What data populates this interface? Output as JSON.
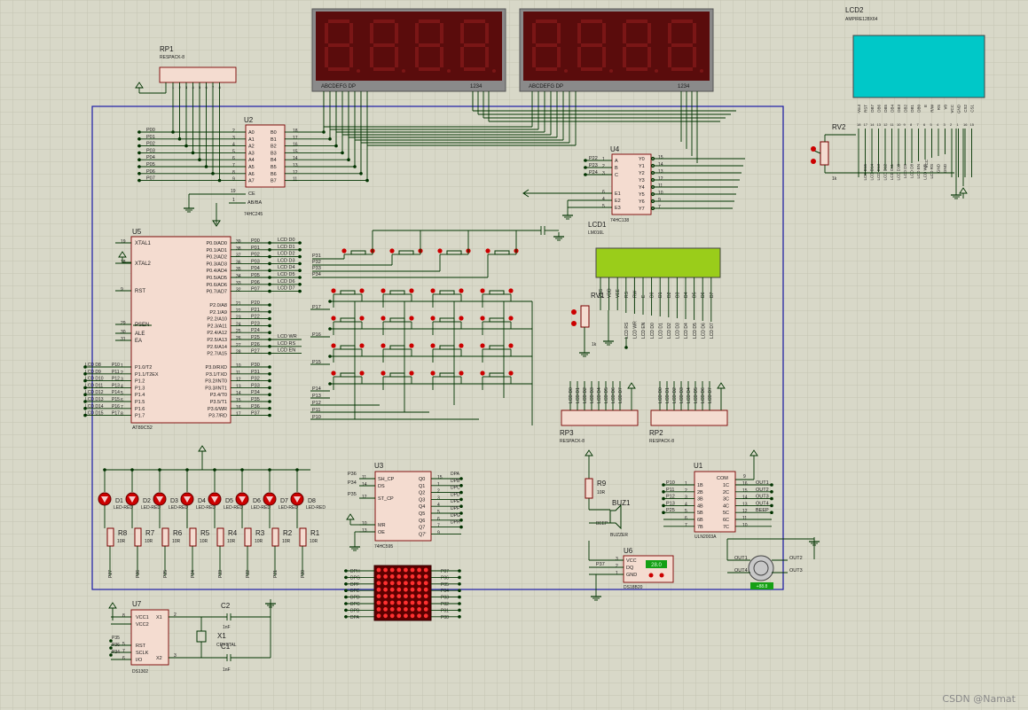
{
  "colors": {
    "grid": "#c8c8b8",
    "background": "#d8d8c8",
    "wire": "#003300",
    "chip_fill": "#f4dcd0",
    "chip_stroke": "#7a0000",
    "board_frame": "#1a1aa6",
    "segment_display_bg": "#5a0c0c",
    "segment_dim": "#7a1616",
    "glcd_screen": "#00c8c8",
    "lcd1602_screen": "#9acd1a",
    "led_red": "#cc0000",
    "matrix_bg": "#5c0000",
    "matrix_dot": "#ff3030",
    "button_red": "#cc0000",
    "temp_display": "#15a015"
  },
  "components": {
    "rp1": {
      "ref": "RP1",
      "value": "RESPACK-8"
    },
    "rp2": {
      "ref": "RP2",
      "value": "RESPACK-8"
    },
    "rp3": {
      "ref": "RP3",
      "value": "RESPACK-8"
    },
    "u2": {
      "ref": "U2",
      "value": "74HC245",
      "left_pins": [
        "A0",
        "A1",
        "A2",
        "A3",
        "A4",
        "A5",
        "A6",
        "A7"
      ],
      "right_pins": [
        "B0",
        "B1",
        "B2",
        "B3",
        "B4",
        "B5",
        "B6",
        "B7"
      ],
      "left_nums": [
        "2",
        "3",
        "4",
        "5",
        "6",
        "7",
        "8",
        "9"
      ],
      "right_nums": [
        "18",
        "17",
        "16",
        "15",
        "14",
        "13",
        "12",
        "11"
      ],
      "ce": "CE",
      "ab": "AB/BA",
      "ce_num": "19",
      "ab_num": "1"
    },
    "u4": {
      "ref": "U4",
      "value": "74HC138",
      "inputs": [
        "A",
        "B",
        "C"
      ],
      "enables": [
        "E1",
        "E2",
        "E3"
      ],
      "outputs": [
        "Y0",
        "Y1",
        "Y2",
        "Y3",
        "Y4",
        "Y5",
        "Y6",
        "Y7"
      ],
      "in_nums": [
        "1",
        "2",
        "3"
      ],
      "en_nums": [
        "6",
        "4",
        "5"
      ],
      "out_nums": [
        "15",
        "14",
        "13",
        "12",
        "11",
        "10",
        "9",
        "7"
      ],
      "in_nets": [
        "P22",
        "P23",
        "P24"
      ]
    },
    "u5": {
      "ref": "U5",
      "value": "AT89C52",
      "left_pins": [
        [
          "19",
          "XTAL1"
        ],
        [
          "18",
          "XTAL2"
        ],
        [
          "9",
          "RST"
        ],
        [
          "29",
          "PSEN"
        ],
        [
          "30",
          "ALE"
        ],
        [
          "31",
          "EA"
        ]
      ],
      "p0": [
        "P0.0/AD0",
        "P0.1/AD1",
        "P0.2/AD2",
        "P0.3/AD3",
        "P0.4/AD4",
        "P0.5/AD5",
        "P0.6/AD6",
        "P0.7/AD7"
      ],
      "p0_nums": [
        "39",
        "38",
        "37",
        "36",
        "35",
        "34",
        "33",
        "32"
      ],
      "p0_nets": [
        "P00",
        "P01",
        "P02",
        "P03",
        "P04",
        "P05",
        "P06",
        "P07"
      ],
      "p2": [
        "P2.0/A8",
        "P2.1/A9",
        "P2.2/A10",
        "P2.3/A11",
        "P2.4/A12",
        "P2.5/A13",
        "P2.6/A14",
        "P2.7/A15"
      ],
      "p2_nums": [
        "21",
        "22",
        "23",
        "24",
        "25",
        "26",
        "27",
        "28"
      ],
      "p2_nets": [
        "P20",
        "P21",
        "P22",
        "P23",
        "P24",
        "P25",
        "P26",
        "P27"
      ],
      "p3": [
        "P3.0/RXD",
        "P3.1/TXD",
        "P3.2/INT0",
        "P3.3/INT1",
        "P3.4/T0",
        "P3.5/T1",
        "P3.6/WR",
        "P3.7/RD"
      ],
      "p3_nums": [
        "10",
        "11",
        "12",
        "13",
        "14",
        "15",
        "16",
        "17"
      ],
      "p3_nets": [
        "P30",
        "P31",
        "P32",
        "P33",
        "P34",
        "P35",
        "P36",
        "P37"
      ],
      "p1": [
        "P1.0/T2",
        "P1.1/T2EX",
        "P1.2",
        "P1.3",
        "P1.4",
        "P1.5",
        "P1.6",
        "P1.7"
      ],
      "p1_nums": [
        "1",
        "2",
        "3",
        "4",
        "5",
        "6",
        "7",
        "8"
      ],
      "p1_nets": [
        "P10",
        "P11",
        "P12",
        "P13",
        "P14",
        "P15",
        "P16",
        "P17"
      ],
      "p1_lcd": [
        "LCD D8",
        "LCD D9",
        "LCD D10",
        "LCD D11",
        "LCD D12",
        "LCD D13",
        "LCD D14",
        "LCD D15"
      ],
      "p0_lcd": [
        "LCD D0",
        "LCD D1",
        "LCD D2",
        "LCD D3",
        "LCD D4",
        "LCD D5",
        "LCD D6",
        "LCD D7"
      ],
      "p2_lcd": [
        "LCD WR",
        "LCD RS",
        "LCD EN"
      ]
    },
    "u3": {
      "ref": "U3",
      "value": "74HC595",
      "left": [
        [
          "14",
          "DS"
        ],
        [
          "11",
          "SH_CP"
        ],
        [
          "12",
          "ST_CP"
        ],
        [
          "10",
          "MR"
        ],
        [
          "13",
          "OE"
        ]
      ],
      "right": [
        "Q0",
        "Q1",
        "Q2",
        "Q3",
        "Q4",
        "Q5",
        "Q6",
        "Q7",
        "Q7'"
      ],
      "right_nums": [
        "15",
        "1",
        "2",
        "3",
        "4",
        "5",
        "6",
        "7",
        "9"
      ],
      "nets_in": [
        "P36",
        "P34",
        "P35"
      ],
      "nets_out": [
        "DPA",
        "DPB",
        "DPC",
        "DPD",
        "DPE",
        "DPF",
        "DPG",
        "DPH"
      ]
    },
    "u1": {
      "ref": "U1",
      "value": "ULN2003A",
      "in": [
        "1B",
        "2B",
        "3B",
        "4B",
        "5B",
        "6B",
        "7B"
      ],
      "out": [
        "1C",
        "2C",
        "3C",
        "4C",
        "5C",
        "6C",
        "7C"
      ],
      "com": "COM",
      "in_nums": [
        "1",
        "2",
        "3",
        "4",
        "5",
        "6",
        "7"
      ],
      "out_nums": [
        "16",
        "15",
        "14",
        "13",
        "12",
        "11",
        "10"
      ],
      "in_nets": [
        "P10",
        "P11",
        "P12",
        "P13",
        "P25"
      ],
      "out_nets": [
        "OUT1",
        "OUT2",
        "OUT3",
        "OUT4",
        "BEEP"
      ],
      "com_num": "9"
    },
    "u6": {
      "ref": "U6",
      "value": "DS18B20",
      "pins": [
        "VCC",
        "DQ",
        "GND"
      ],
      "nums": [
        "3",
        "2",
        "1"
      ],
      "net": "P37",
      "display": "28.0"
    },
    "u7": {
      "ref": "U7",
      "value": "DS1302",
      "pins_left": [
        "VCC1",
        "VCC2",
        "RST",
        "SCLK",
        "I/O"
      ],
      "pins_right": [
        "X1",
        "X2"
      ],
      "nets": [
        "P35",
        "P36",
        "P34"
      ],
      "nums_left": [
        "8",
        "",
        "5",
        "7",
        "6"
      ],
      "nums_right": [
        "2",
        "3"
      ]
    },
    "lcd1": {
      "ref": "LCD1",
      "value": "LM016L",
      "pins": [
        "VSS",
        "VDD",
        "VEE",
        "RS",
        "RW",
        "E",
        "D0",
        "D1",
        "D2",
        "D3",
        "D4",
        "D5",
        "D6",
        "D7"
      ],
      "nets": [
        "LCD RS",
        "LCD WR",
        "LCD EN",
        "LCD D0",
        "LCD D1",
        "LCD D2",
        "LCD D3",
        "LCD D4",
        "LCD D5",
        "LCD D6",
        "LCD D7"
      ]
    },
    "lcd2": {
      "ref": "LCD2",
      "value": "AMPIRE128X64",
      "pins": [
        "-Vout",
        "RST",
        "DB7",
        "DB6",
        "DB5",
        "DB4",
        "DB3",
        "DB2",
        "DB1",
        "DB0",
        "E",
        "R/W",
        "RS",
        "V0",
        "VCC",
        "GND",
        "CS2",
        "CS1"
      ],
      "nums": [
        "18",
        "17",
        "14",
        "13",
        "12",
        "11",
        "10",
        "9",
        "8",
        "7",
        "6",
        "5",
        "4",
        "3",
        "2",
        "1",
        "16",
        "15"
      ],
      "nets": [
        "LCD D15",
        "LCD D14",
        "LCD D13",
        "LCD D12",
        "LCD D11",
        "LCD D10",
        "LCD D9",
        "LCD D8",
        "LCD EN",
        "LCD WR",
        "LCD RS",
        "GND",
        "GND"
      ],
      "vcc": "VCC"
    },
    "rv1": {
      "ref": "RV1",
      "value": "1k"
    },
    "rv2": {
      "ref": "RV2",
      "value": "1k"
    },
    "r9": {
      "ref": "R9",
      "value": "10R"
    },
    "buz1": {
      "ref": "BUZ1",
      "value": "BUZZER",
      "net": "BEEP"
    },
    "x1": {
      "ref": "X1",
      "value": "CRYSTAL"
    },
    "c1": {
      "ref": "C1",
      "value": "1nF"
    },
    "c2": {
      "ref": "C2",
      "value": "1nF"
    },
    "seg_labels": {
      "left": "ABCDEFG  DP",
      "left_digits": "1234",
      "right": "ABCDEFG  DP",
      "right_digits": "1234"
    },
    "leds": [
      {
        "ref": "D1",
        "value": "LED-RED"
      },
      {
        "ref": "D2",
        "value": "LED-RED"
      },
      {
        "ref": "D3",
        "value": "LED-RED"
      },
      {
        "ref": "D4",
        "value": "LED-RED"
      },
      {
        "ref": "D5",
        "value": "LED-RED"
      },
      {
        "ref": "D6",
        "value": "LED-RED"
      },
      {
        "ref": "D7",
        "value": "LED-RED"
      },
      {
        "ref": "D8",
        "value": "LED-RED"
      }
    ],
    "resistors": [
      {
        "ref": "R8",
        "value": "10R",
        "net": "P27"
      },
      {
        "ref": "R7",
        "value": "10R",
        "net": "P26"
      },
      {
        "ref": "R6",
        "value": "10R",
        "net": "P25"
      },
      {
        "ref": "R5",
        "value": "10R",
        "net": "P24"
      },
      {
        "ref": "R4",
        "value": "10R",
        "net": "P23"
      },
      {
        "ref": "R3",
        "value": "10R",
        "net": "P22"
      },
      {
        "ref": "R2",
        "value": "10R",
        "net": "P21"
      },
      {
        "ref": "R1",
        "value": "10R",
        "net": "P20"
      }
    ],
    "keys_top_nets": [
      "P31",
      "P32",
      "P33",
      "P34"
    ],
    "matrix_rows": [
      "P17",
      "P16",
      "P15",
      "P14",
      "P13",
      "P12",
      "P11",
      "P10"
    ],
    "dot_matrix_left": [
      "DPH",
      "DPG",
      "DPF",
      "DPE",
      "DPD",
      "DPC",
      "DPB",
      "DPA"
    ],
    "dot_matrix_right": [
      "P07",
      "P06",
      "P05",
      "P04",
      "P03",
      "P02",
      "P01",
      "P00"
    ],
    "motor": {
      "nets_left": [
        "OUT1",
        "OUT4"
      ],
      "nets_right": [
        "OUT2",
        "OUT3"
      ],
      "display": "+88.8"
    },
    "rp1_nets": [
      "P00",
      "P01",
      "P02",
      "P03",
      "P04",
      "P05",
      "P06",
      "P07"
    ]
  },
  "watermark": "CSDN @Namat"
}
